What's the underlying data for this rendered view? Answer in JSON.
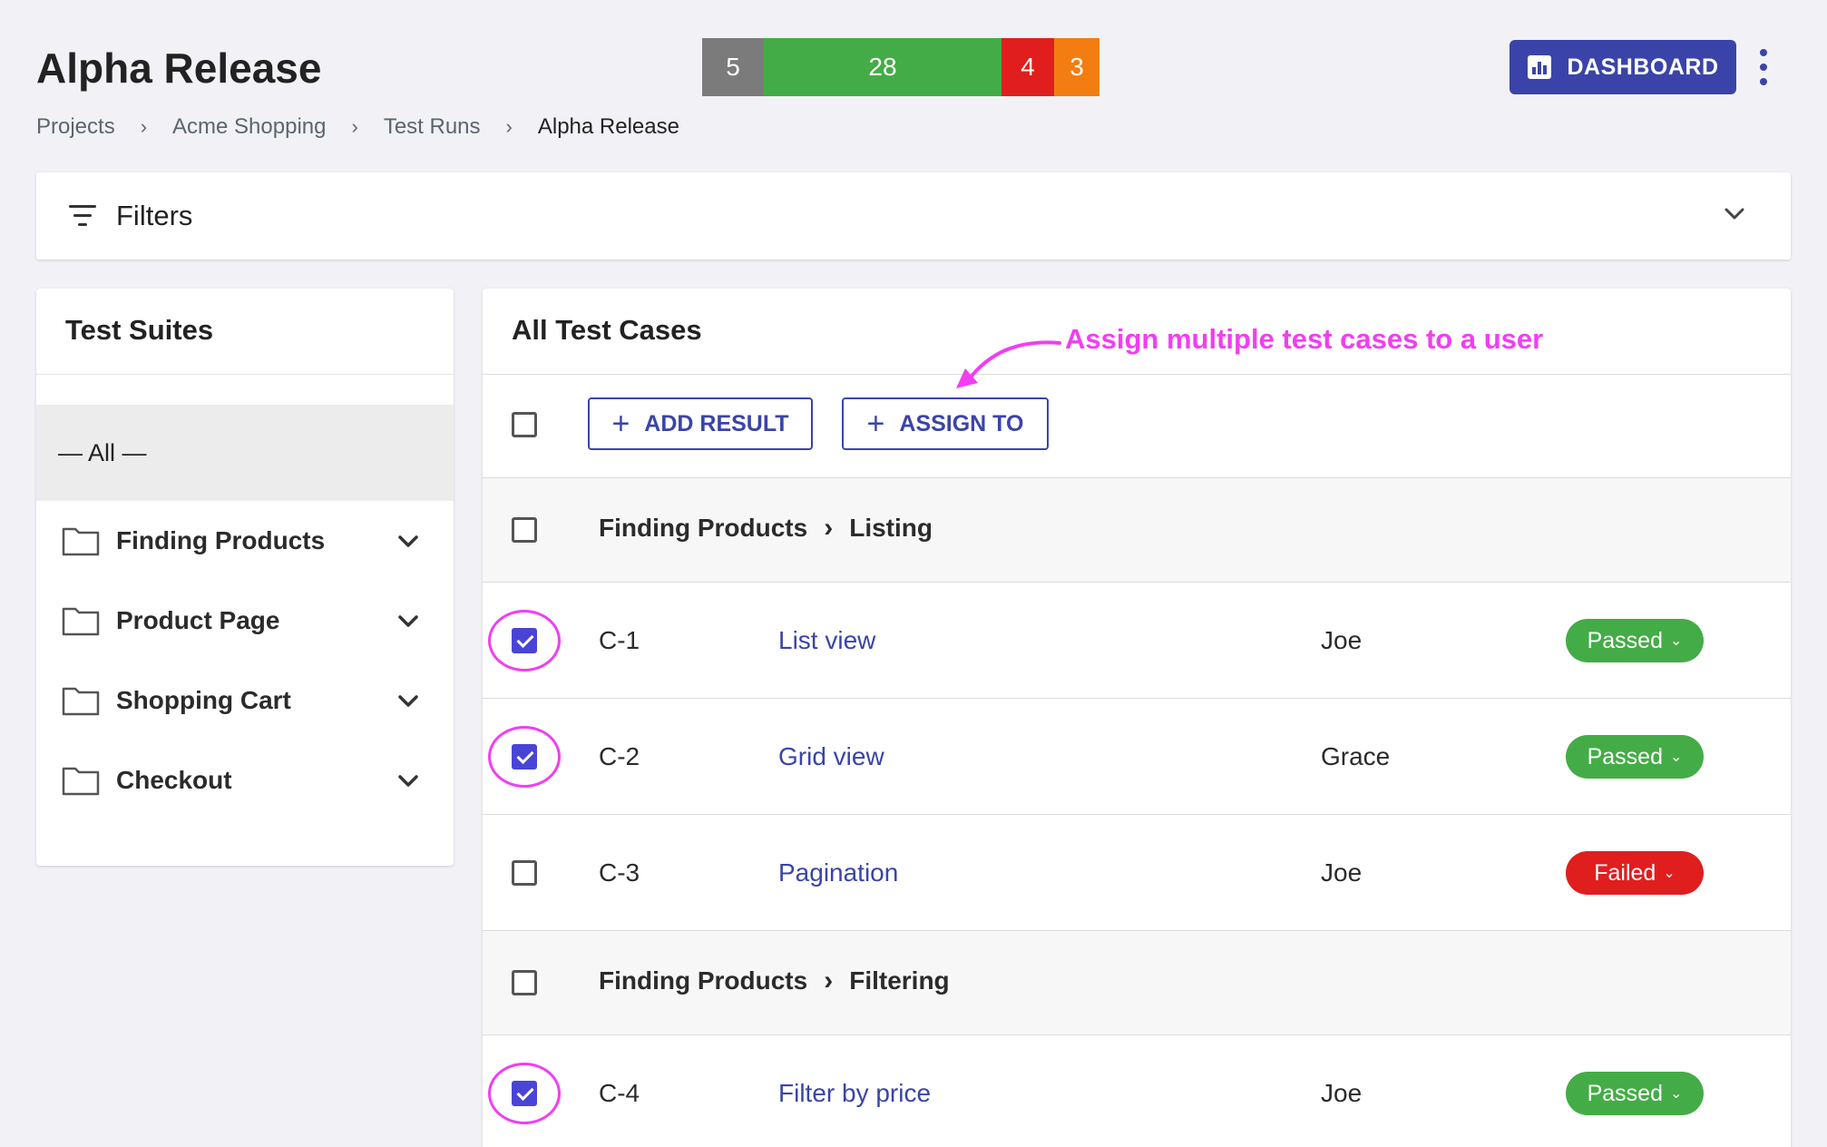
{
  "header": {
    "title": "Alpha Release",
    "breadcrumb": [
      "Projects",
      "Acme Shopping",
      "Test Runs",
      "Alpha Release"
    ],
    "breadcrumb_separator": "›",
    "dashboard_label": "DASHBOARD",
    "dashboard_color": "#3a44a8"
  },
  "stats": [
    {
      "value": "5",
      "color": "#7b7b7b",
      "fraction": 0.125
    },
    {
      "value": "28",
      "color": "#44ac46",
      "fraction": 0.7
    },
    {
      "value": "4",
      "color": "#e01e1e",
      "fraction": 0.1
    },
    {
      "value": "3",
      "color": "#f47d12",
      "fraction": 0.075
    }
  ],
  "filters": {
    "label": "Filters"
  },
  "suites": {
    "title": "Test Suites",
    "all_label": "— All —",
    "items": [
      {
        "label": "Finding Products"
      },
      {
        "label": "Product Page"
      },
      {
        "label": "Shopping Cart"
      },
      {
        "label": "Checkout"
      }
    ]
  },
  "cases": {
    "title": "All Test Cases",
    "add_result_label": "ADD RESULT",
    "assign_to_label": "ASSIGN TO",
    "annotation": "Assign multiple test cases to a user",
    "groups": [
      {
        "parent": "Finding Products",
        "child": "Listing"
      },
      {
        "parent": "Finding Products",
        "child": "Filtering"
      }
    ],
    "rows": [
      {
        "id": "C-1",
        "title": "List view",
        "user": "Joe",
        "status": "Passed",
        "status_color": "#44ac46",
        "checked": true
      },
      {
        "id": "C-2",
        "title": "Grid view",
        "user": "Grace",
        "status": "Passed",
        "status_color": "#44ac46",
        "checked": true
      },
      {
        "id": "C-3",
        "title": "Pagination",
        "user": "Joe",
        "status": "Failed",
        "status_color": "#e01e1e",
        "checked": false
      },
      {
        "id": "C-4",
        "title": "Filter by price",
        "user": "Joe",
        "status": "Passed",
        "status_color": "#44ac46",
        "checked": true
      }
    ]
  },
  "colors": {
    "accent": "#3a44a8",
    "checkbox_checked": "#4a44d6",
    "annotation": "#f23df2"
  }
}
